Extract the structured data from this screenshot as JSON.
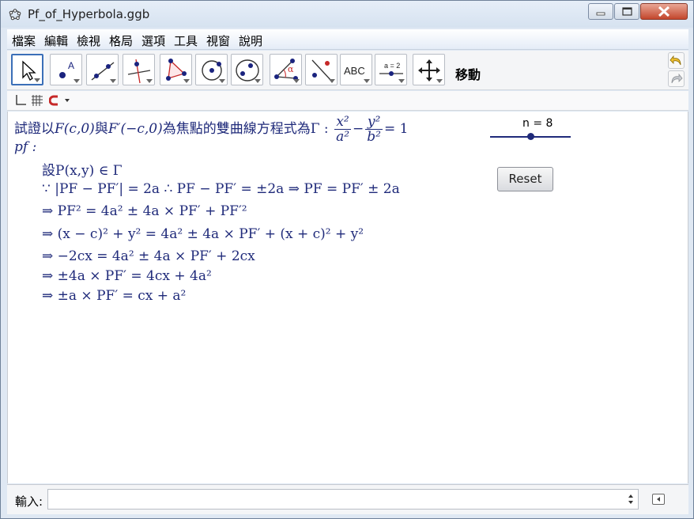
{
  "window": {
    "title": "Pf_of_Hyperbola.ggb"
  },
  "menu": [
    "檔案",
    "編輯",
    "檢視",
    "格局",
    "選項",
    "工具",
    "視窗",
    "說明"
  ],
  "toolbar": {
    "active_tool_label": "移動",
    "tools": [
      "move",
      "point",
      "line",
      "perpendicular",
      "polygon",
      "circle",
      "conic",
      "angle",
      "reflect",
      "text",
      "slider",
      "move-graphics"
    ],
    "text_tool_caption": "ABC",
    "slider_tool_caption": "a = 2"
  },
  "graphics": {
    "header": {
      "prefix": "試證以",
      "f1": "F(c,0)",
      "mid": "與",
      "f2": "F′(−c,0)",
      "suffix": "為焦點的雙曲線方程式為Γ :",
      "frac1_num": "x²",
      "frac1_den": "a²",
      "minus": "−",
      "frac2_num": "y²",
      "frac2_den": "b²",
      "rhs": "= 1"
    },
    "pf_label": "pf :",
    "proof_lines": [
      "設P(x,y) ∈ Γ",
      "∵ |PF − PF′| = 2a  ∴ PF − PF′ = ±2a ⇒ PF = PF′ ± 2a",
      "⇒ PF² = 4a² ± 4a × PF′ + PF′²",
      "⇒ (x − c)² + y² = 4a² ± 4a × PF′ + (x + c)² + y²",
      "⇒ −2cx = 4a² ± 4a × PF′ + 2cx",
      "⇒ ±4a × PF′ = 4cx + 4a²",
      "⇒ ±a × PF′ = cx + a²"
    ],
    "slider": {
      "label": "n = 8",
      "value_fraction": 0.5
    },
    "reset_label": "Reset"
  },
  "input_bar": {
    "label": "輸入:",
    "value": ""
  }
}
